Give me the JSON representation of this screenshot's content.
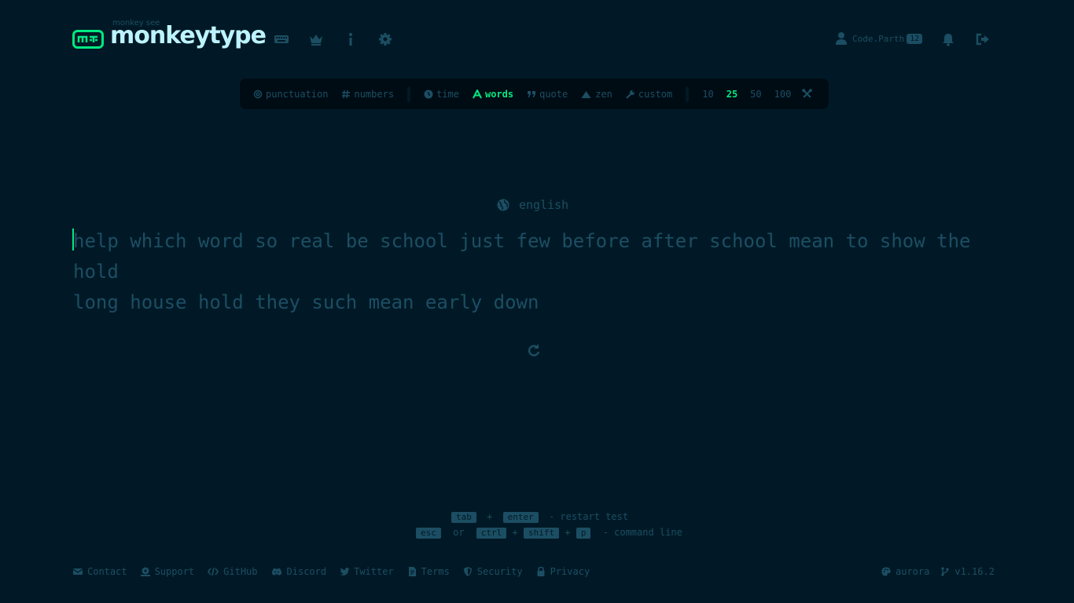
{
  "header": {
    "logo_subtitle": "monkey see",
    "logo_title": "monkeytype",
    "account": {
      "name": "Code.Parth",
      "level": "12"
    }
  },
  "config": {
    "punctuation": "punctuation",
    "numbers": "numbers",
    "modes": [
      "time",
      "words",
      "quote",
      "zen",
      "custom"
    ],
    "active_mode": "words",
    "word_counts": [
      "10",
      "25",
      "50",
      "100"
    ],
    "active_count": "25"
  },
  "test": {
    "language": "english",
    "line1": "help which word so real be school just few before after school mean to show the hold",
    "line2": "long house hold they such mean early down"
  },
  "shortcuts": {
    "tab": "tab",
    "plus": "+",
    "enter": "enter",
    "restart_text": "- restart test",
    "esc": "esc",
    "or": "or",
    "ctrl": "ctrl",
    "shift": "shift",
    "p": "p",
    "command_text": "- command line"
  },
  "footer": {
    "links": [
      "Contact",
      "Support",
      "GitHub",
      "Discord",
      "Twitter",
      "Terms",
      "Security",
      "Privacy"
    ],
    "theme": "aurora",
    "version": "v1.16.2"
  },
  "colors": {
    "bg": "#011926",
    "accent": "#00e980",
    "sub": "#1c4e63",
    "text": "#bdf3ff"
  }
}
